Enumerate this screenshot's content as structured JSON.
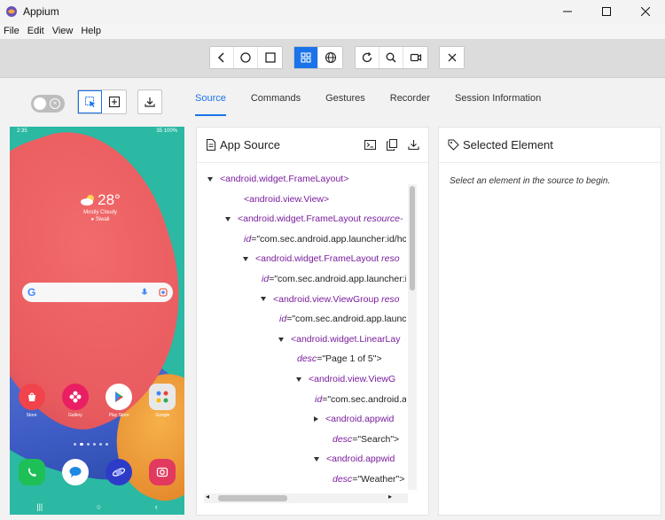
{
  "window": {
    "title": "Appium"
  },
  "menu": [
    "File",
    "Edit",
    "View",
    "Help"
  ],
  "tabs": [
    "Source",
    "Commands",
    "Gestures",
    "Recorder",
    "Session Information"
  ],
  "device": {
    "status_time": "2:35",
    "status_right": "35 100%",
    "weather": {
      "temp": "28°",
      "condition": "Mostly Cloudy",
      "location": "Siwali"
    },
    "apps_row1": [
      "Store",
      "Gallery",
      "Play Store",
      "Google"
    ],
    "apps_row1_colors": [
      "#f0434b",
      "#e91e63",
      "#ffffff",
      "#e8e8e8"
    ],
    "dock_colors": [
      "#1fbf57",
      "#1e88e5",
      "#2d3cc8",
      "#e2395f"
    ],
    "page_dots": 6,
    "current_page": 1
  },
  "source_panel": {
    "title": "App Source",
    "tree": [
      {
        "depth": 0,
        "arrow": "down",
        "tag": "<android.widget.FrameLayout>",
        "attr": "",
        "attr_val": ""
      },
      {
        "depth": 1,
        "arrow": "none",
        "tag": "<android.view.View>",
        "attr": "",
        "attr_val": ""
      },
      {
        "depth": 1,
        "arrow": "down",
        "tag": "<android.widget.FrameLayout",
        "attr": "resource-",
        "attr_val": ""
      },
      {
        "depth": 1,
        "arrow": "cont",
        "tag": "",
        "attr": "id",
        "attr_val": "=\"com.sec.android.app.launcher:id/hc"
      },
      {
        "depth": 2,
        "arrow": "down",
        "tag": "<android.widget.FrameLayout",
        "attr": "reso",
        "attr_val": ""
      },
      {
        "depth": 2,
        "arrow": "cont",
        "tag": "",
        "attr": "id",
        "attr_val": "=\"com.sec.android.app.launcher:i"
      },
      {
        "depth": 3,
        "arrow": "down",
        "tag": "<android.view.ViewGroup",
        "attr": "reso",
        "attr_val": ""
      },
      {
        "depth": 3,
        "arrow": "cont",
        "tag": "",
        "attr": "id",
        "attr_val": "=\"com.sec.android.app.launch"
      },
      {
        "depth": 4,
        "arrow": "down",
        "tag": "<android.widget.LinearLay",
        "attr": "",
        "attr_val": ""
      },
      {
        "depth": 4,
        "arrow": "cont",
        "tag": "",
        "attr": "desc",
        "attr_val": "=\"Page 1 of 5\">"
      },
      {
        "depth": 5,
        "arrow": "down",
        "tag": "<android.view.ViewG",
        "attr": "",
        "attr_val": ""
      },
      {
        "depth": 5,
        "arrow": "cont",
        "tag": "",
        "attr": "id",
        "attr_val": "=\"com.sec.android.a"
      },
      {
        "depth": 6,
        "arrow": "right",
        "tag": "<android.appwid",
        "attr": "",
        "attr_val": ""
      },
      {
        "depth": 6,
        "arrow": "cont",
        "tag": "",
        "attr": "desc",
        "attr_val": "=\"Search\">"
      },
      {
        "depth": 6,
        "arrow": "down",
        "tag": "<android.appwid",
        "attr": "",
        "attr_val": ""
      },
      {
        "depth": 6,
        "arrow": "cont",
        "tag": "",
        "attr": "desc",
        "attr_val": "=\"Weather\">"
      }
    ]
  },
  "selected_panel": {
    "title": "Selected Element",
    "message": "Select an element in the source to begin."
  },
  "colors": {
    "accent": "#1a73e8",
    "tag": "#7a1d9e"
  }
}
